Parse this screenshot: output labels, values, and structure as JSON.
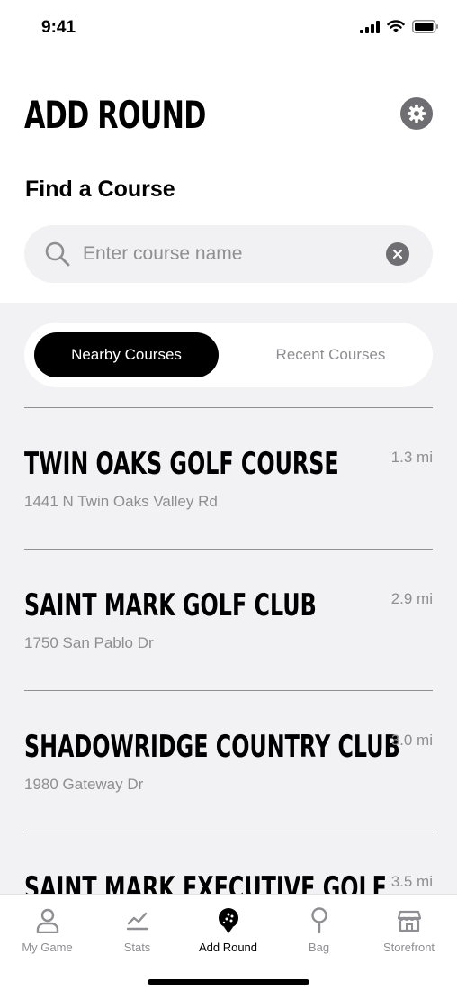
{
  "status_bar": {
    "time": "9:41"
  },
  "header": {
    "title": "ADD ROUND"
  },
  "find": {
    "label": "Find a Course",
    "search_placeholder": "Enter course name",
    "search_value": ""
  },
  "segments": {
    "nearby": "Nearby Courses",
    "recent": "Recent Courses",
    "selected": "Nearby Courses"
  },
  "courses": [
    {
      "name": "TWIN OAKS GOLF COURSE",
      "address": "1441 N Twin Oaks Valley Rd",
      "distance": "1.3 mi"
    },
    {
      "name": "SAINT MARK GOLF CLUB",
      "address": "1750 San Pablo Dr",
      "distance": "2.9 mi"
    },
    {
      "name": "SHADOWRIDGE COUNTRY CLUB",
      "address": "1980 Gateway Dr",
      "distance": "3.0 mi"
    },
    {
      "name": "SAINT MARK EXECUTIVE GOLF",
      "address": "",
      "distance": "3.5 mi"
    }
  ],
  "tab_bar": {
    "items": [
      {
        "label": "My Game",
        "icon": "person-icon"
      },
      {
        "label": "Stats",
        "icon": "chart-icon"
      },
      {
        "label": "Add Round",
        "icon": "golf-ball-icon"
      },
      {
        "label": "Bag",
        "icon": "golf-tee-icon"
      },
      {
        "label": "Storefront",
        "icon": "storefront-icon"
      }
    ],
    "active": "Add Round"
  },
  "colors": {
    "accent": "#000000",
    "secondary_text": "#8e8e93",
    "list_background": "#f2f2f4",
    "search_background": "#f1f1f3"
  }
}
